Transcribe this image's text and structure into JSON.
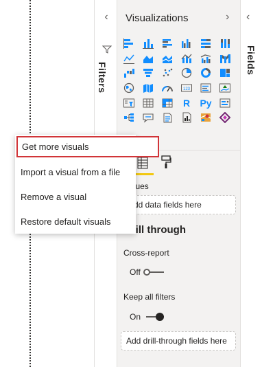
{
  "filters_pane": {
    "label": "Filters",
    "collapse_icon": "chevron-left-icon",
    "filter_icon": "funnel-icon"
  },
  "visualizations_pane": {
    "title": "Visualizations",
    "expand_icon": "chevron-right-icon",
    "visual_icons": [
      "stacked-bar-chart",
      "stacked-column-chart",
      "clustered-bar-chart",
      "clustered-column-chart",
      "100-stacked-bar-chart",
      "100-stacked-column-chart",
      "line-chart",
      "area-chart",
      "stacked-area-chart",
      "line-and-stacked-column-chart",
      "line-and-clustered-column-chart",
      "ribbon-chart",
      "waterfall-chart",
      "funnel-chart",
      "scatter-chart",
      "pie-chart",
      "donut-chart",
      "treemap",
      "map",
      "filled-map",
      "gauge",
      "card",
      "multi-row-card",
      "kpi",
      "slicer",
      "table",
      "matrix",
      "r-script-visual",
      "python-visual",
      "key-influencers",
      "decomposition-tree",
      "q-and-a",
      "smart-narrative",
      "paginated-report",
      "azure-map",
      "power-apps"
    ],
    "r_label": "R",
    "py_label": "Py",
    "more_label": "...",
    "values_label": "Values",
    "values_placeholder": "Add data fields here",
    "drill_through_title": "Drill through",
    "cross_report_label": "Cross-report",
    "cross_report_state": "Off",
    "keep_filters_label": "Keep all filters",
    "keep_filters_state": "On",
    "drill_placeholder": "Add drill-through fields here"
  },
  "fields_pane": {
    "label": "Fields",
    "collapse_icon": "chevron-left-icon"
  },
  "context_menu": {
    "items": [
      {
        "label": "Get more visuals",
        "highlighted": true
      },
      {
        "label": "Import a visual from a file"
      },
      {
        "label": "Remove a visual"
      },
      {
        "label": "Restore default visuals"
      }
    ]
  },
  "colors": {
    "accent_blue": "#118dff",
    "highlight_red": "#d13438",
    "tab_yellow": "#f2c811",
    "pane_bg": "#f3f2f1"
  }
}
